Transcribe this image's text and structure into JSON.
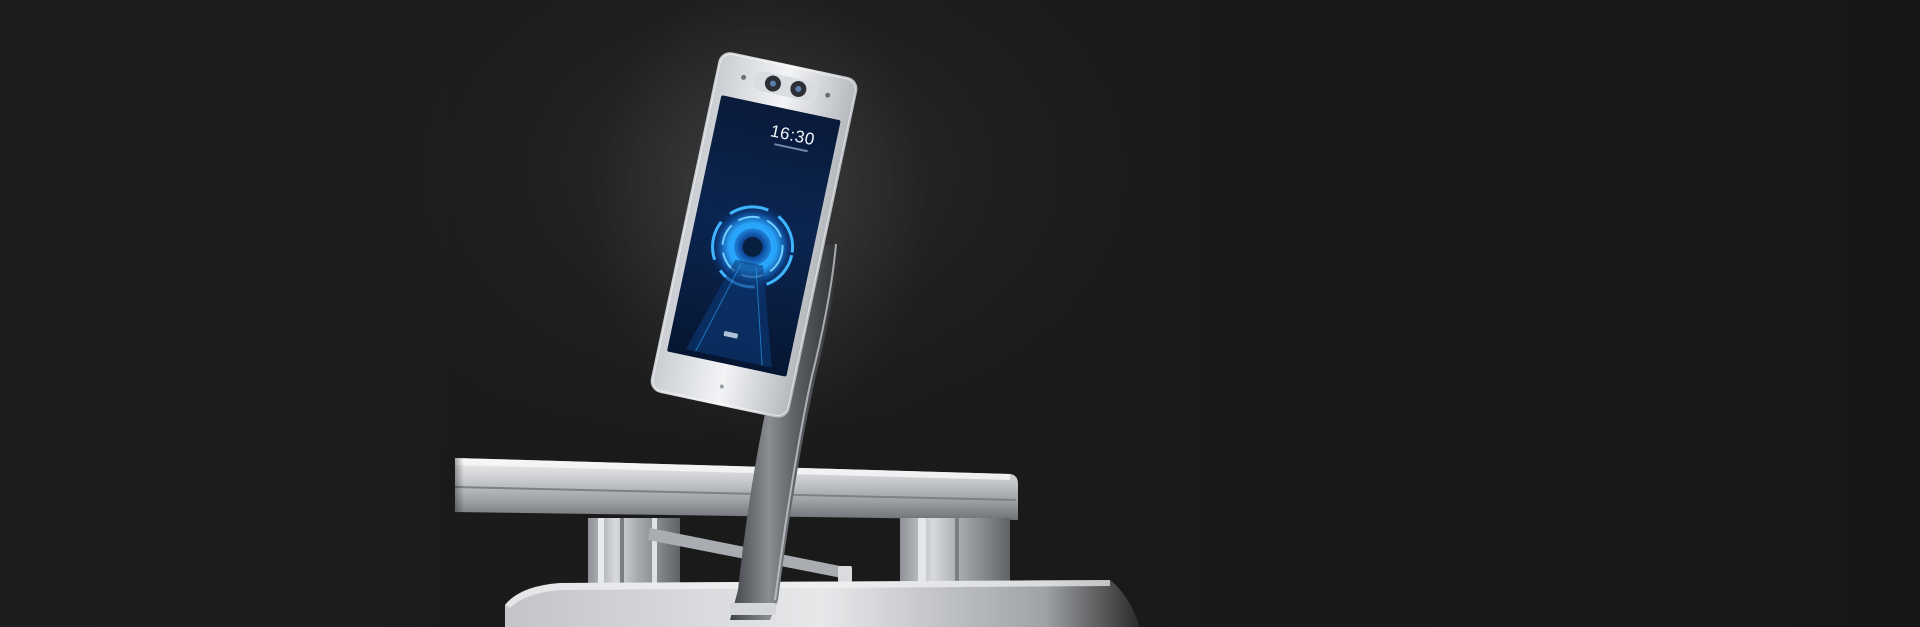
{
  "scene": {
    "description_hidden": "",
    "device": {
      "screen_time": "16:30",
      "screen_accent": "#2aa8ff",
      "bezel_color": "#e9ebee",
      "stand_color": "#5a5d62"
    },
    "background_color": "#161616",
    "turnstile_color": "#b9bcc0"
  }
}
